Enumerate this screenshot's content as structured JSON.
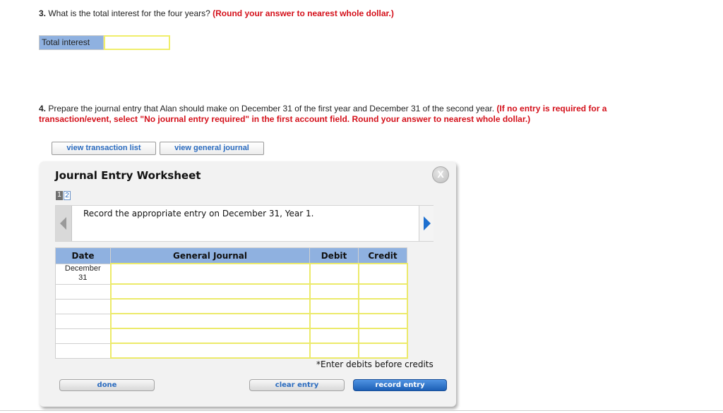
{
  "q3": {
    "number": "3.",
    "text": " What is the total interest for the four years? ",
    "instruction": "(Round your answer to nearest whole dollar.)",
    "row_label": "Total interest",
    "input_value": ""
  },
  "q4": {
    "number": "4.",
    "text": " Prepare the journal entry that Alan should make on December 31 of the first year and December 31 of the second year. ",
    "instruction": "(If no entry is required for a transaction/event, select \"No journal entry required\" in the first account field. Round your answer to nearest whole dollar.)"
  },
  "links": {
    "view_transaction_list": "view transaction list",
    "view_general_journal": "view general journal"
  },
  "worksheet": {
    "title": "Journal Entry Worksheet",
    "close_label": "X",
    "pages": [
      "1",
      "2"
    ],
    "current_page": 1,
    "instruction": "Record the appropriate entry on December 31, Year 1.",
    "columns": [
      "Date",
      "General Journal",
      "Debit",
      "Credit"
    ],
    "rows": [
      {
        "date": "December\n31",
        "account": "",
        "debit": "",
        "credit": ""
      },
      {
        "date": "",
        "account": "",
        "debit": "",
        "credit": ""
      },
      {
        "date": "",
        "account": "",
        "debit": "",
        "credit": ""
      },
      {
        "date": "",
        "account": "",
        "debit": "",
        "credit": ""
      },
      {
        "date": "",
        "account": "",
        "debit": "",
        "credit": ""
      },
      {
        "date": "",
        "account": "",
        "debit": "",
        "credit": ""
      }
    ],
    "date_line1": "December",
    "date_line2": "31",
    "hint": "*Enter debits before credits",
    "buttons": {
      "done": "done",
      "clear_entry": "clear entry",
      "record_entry": "record entry"
    }
  }
}
